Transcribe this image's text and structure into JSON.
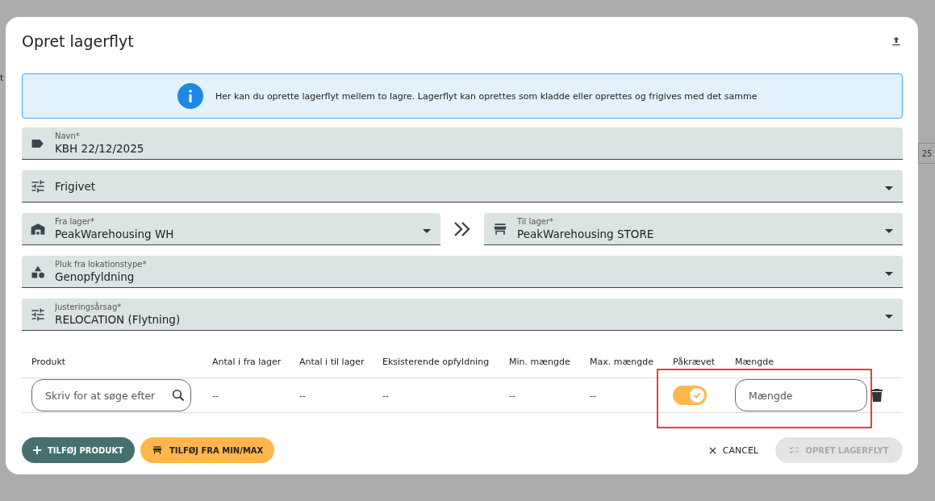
{
  "backdrop": {
    "left_text": "t",
    "right_text": "25"
  },
  "dialog": {
    "title": "Opret lagerflyt"
  },
  "info": "Her kan du oprette lagerflyt mellem to lagre. Lagerflyt kan oprettes som kladde eller oprettes og frigives med det samme",
  "fields": [
    {
      "kind": "text",
      "label": "Navn*",
      "value": "KBH 22/12/2025"
    },
    {
      "kind": "select",
      "value": "Frigivet"
    }
  ],
  "warehouses": {
    "from": {
      "label": "Fra lager*",
      "value": "PeakWarehousing WH"
    },
    "to": {
      "label": "Til lager*",
      "value": "PeakWarehousing STORE"
    }
  },
  "fields_after": [
    {
      "kind": "select",
      "label": "Pluk fra lokationstype*",
      "value": "Genopfyldning"
    },
    {
      "kind": "select",
      "label": "Justeringsårsag*",
      "value": "RELOCATION (Flytning)"
    }
  ],
  "table": {
    "columns": [
      "Produkt",
      "Antal i fra lager",
      "Antal i til lager",
      "Eksisterende opfyldning",
      "Min. mængde",
      "Max. mængde",
      "Påkrævet",
      "Mængde"
    ],
    "rows": [
      {
        "cells": [
          {
            "kind": "search",
            "placeholder": "Skriv for at søge efter"
          },
          {
            "kind": "text",
            "text": "--"
          },
          {
            "kind": "text",
            "text": "--"
          },
          {
            "kind": "text",
            "text": "--"
          },
          {
            "kind": "text",
            "text": "--"
          },
          {
            "kind": "text",
            "text": "--"
          },
          {
            "kind": "toggle",
            "on": true
          },
          {
            "kind": "input",
            "placeholder": "Mængde"
          }
        ]
      }
    ]
  },
  "buttons": {
    "add_product": "TILFØJ PRODUKT",
    "add_minmax": "TILFØJ FRA MIN/MAX",
    "cancel": "CANCEL",
    "create": {
      "label": "OPRET LAGERFLYT",
      "disabled": true
    }
  }
}
